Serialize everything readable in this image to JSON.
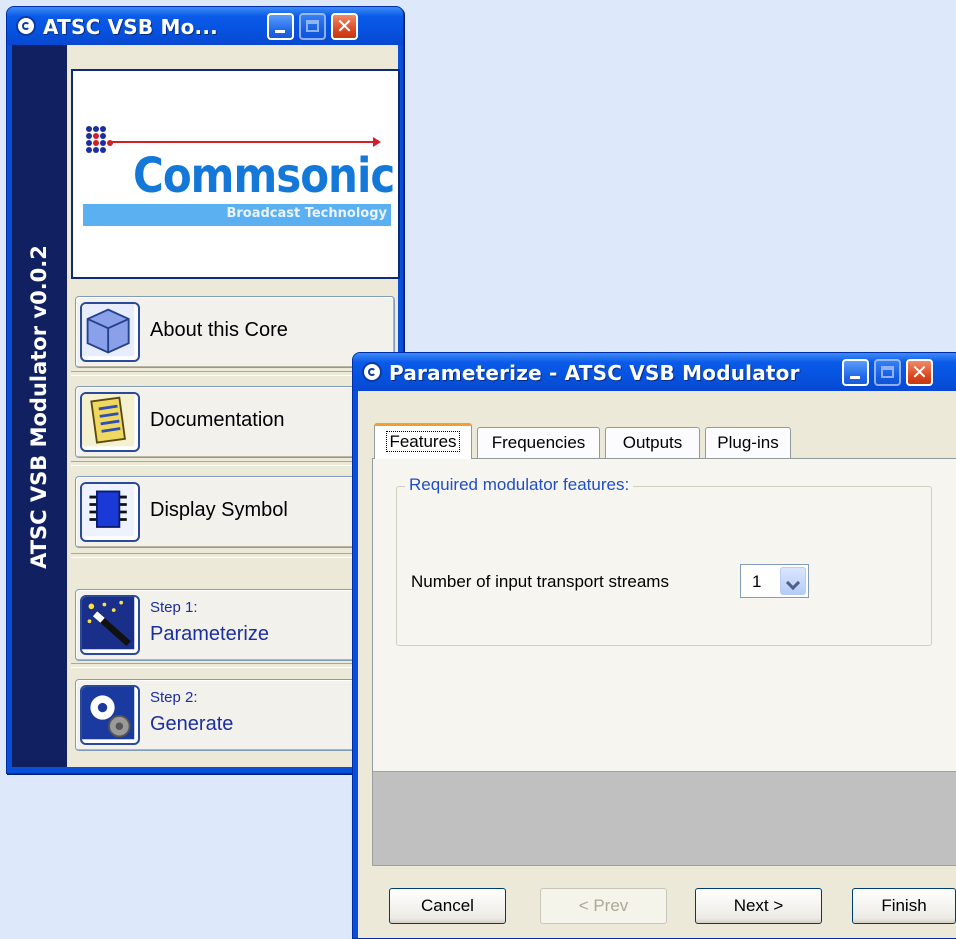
{
  "main_window": {
    "title": "ATSC VSB Mo...",
    "vertical_title": "ATSC VSB Modulator v0.0.2",
    "logo": {
      "word": "Commsonic",
      "tagline": "Broadcast Technology"
    },
    "buttons": [
      {
        "label": "About this Core",
        "icon": "cube-icon"
      },
      {
        "label": "Documentation",
        "icon": "document-icon"
      },
      {
        "label": "Display Symbol",
        "icon": "chip-icon"
      },
      {
        "step": "Step 1:",
        "label": "Parameterize",
        "icon": "wand-icon"
      },
      {
        "step": "Step 2:",
        "label": "Generate",
        "icon": "gears-icon"
      }
    ]
  },
  "param_window": {
    "title": "Parameterize - ATSC VSB Modulator",
    "tabs": [
      {
        "label": "Features",
        "active": true
      },
      {
        "label": "Frequencies",
        "active": false
      },
      {
        "label": "Outputs",
        "active": false
      },
      {
        "label": "Plug-ins",
        "active": false
      }
    ],
    "group_title": "Required modulator features:",
    "streams_label": "Number of input transport streams",
    "streams_value": "1",
    "buttons": {
      "cancel": "Cancel",
      "prev": "< Prev",
      "next": "Next >",
      "finish": "Finish"
    }
  },
  "colors": {
    "titlebar": "#0a5ae8",
    "sidebar_band": "#102060",
    "accent_blue": "#1c2ea0",
    "logo_blue": "#1478d8"
  }
}
